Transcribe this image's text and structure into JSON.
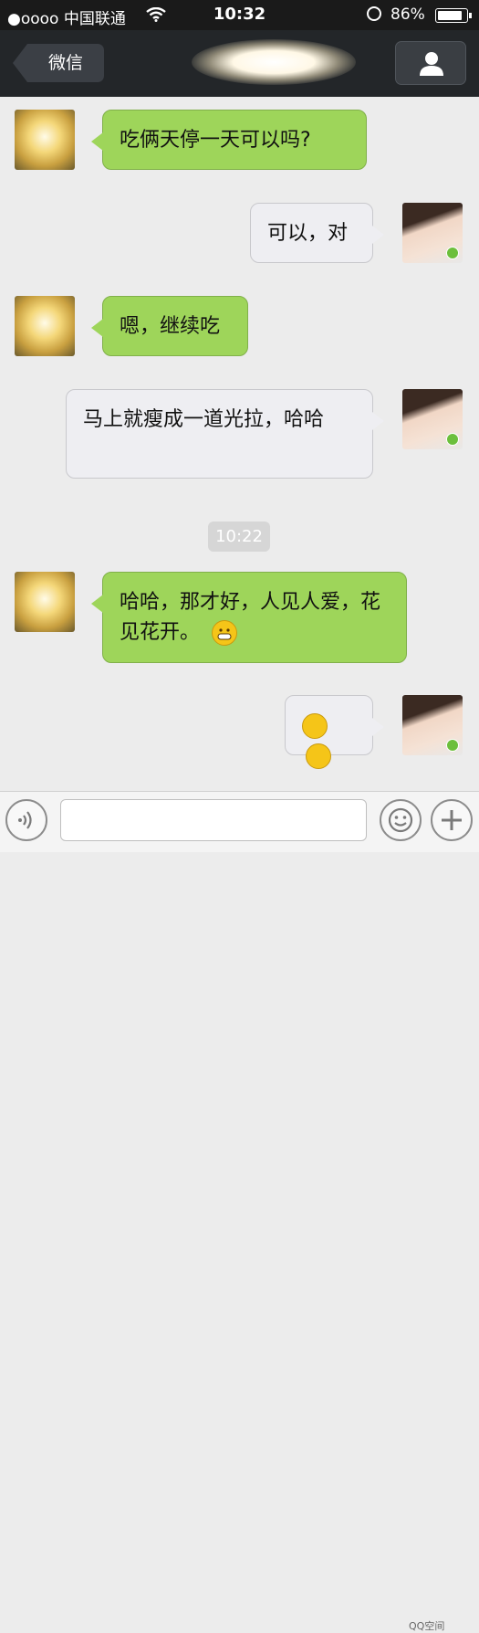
{
  "status_bar": {
    "carrier": "●oooo 中国联通",
    "time": "10:32",
    "battery": "86%"
  },
  "nav": {
    "back_label": "微信"
  },
  "messages": [
    {
      "side": "left",
      "text": "吃俩天停一天可以吗?"
    },
    {
      "side": "right",
      "text": "可以，对"
    },
    {
      "side": "left",
      "text": "嗯，继续吃"
    },
    {
      "side": "right",
      "text": "马上就瘦成一道光拉，哈哈"
    },
    {
      "side": "left",
      "text": "哈哈，那才好，人见人爱，花见花开。"
    },
    {
      "side": "right",
      "text": ""
    }
  ],
  "timestamp": "10:22",
  "watermark": "QQ空间",
  "colors": {
    "nav_bg": "#232629",
    "bubble_green": "#9ed55a",
    "bubble_white": "#eeeef2",
    "chat_bg": "#ececec"
  },
  "icons": {
    "profile": "person-icon",
    "voice": "voice-icon",
    "emoji": "smiley-icon",
    "plus": "plus-icon"
  }
}
